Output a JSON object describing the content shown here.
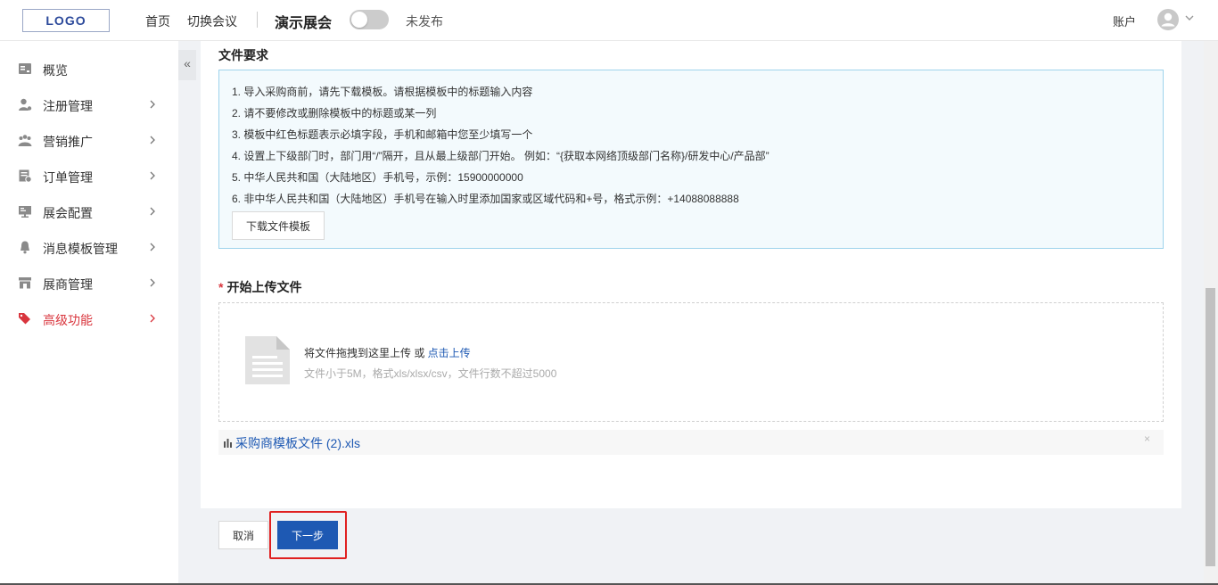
{
  "header": {
    "logo_text": "LOGO",
    "nav_home": "首页",
    "nav_switch": "切换会议",
    "event_title": "演示展会",
    "publish_status": "未发布",
    "account_label": "账户"
  },
  "sidebar": {
    "collapse_label": "«",
    "items": [
      {
        "label": "概览",
        "icon": "overview-icon",
        "has_arrow": false
      },
      {
        "label": "注册管理",
        "icon": "user-manage-icon",
        "has_arrow": true
      },
      {
        "label": "营销推广",
        "icon": "marketing-icon",
        "has_arrow": true
      },
      {
        "label": "订单管理",
        "icon": "order-icon",
        "has_arrow": true
      },
      {
        "label": "展会配置",
        "icon": "monitor-icon",
        "has_arrow": true
      },
      {
        "label": "消息模板管理",
        "icon": "bell-icon",
        "has_arrow": true
      },
      {
        "label": "展商管理",
        "icon": "store-icon",
        "has_arrow": true
      },
      {
        "label": "高级功能",
        "icon": "tags-icon",
        "has_arrow": true,
        "active": true
      }
    ]
  },
  "requirements": {
    "title": "文件要求",
    "lines": [
      "1. 导入采购商前，请先下载模板。请根据模板中的标题输入内容",
      "2. 请不要修改或删除模板中的标题或某一列",
      "3. 模板中红色标题表示必填字段，手机和邮箱中您至少填写一个",
      "4. 设置上下级部门时，部门用“/”隔开，且从最上级部门开始。 例如：“{获取本网络顶级部门名称}/研发中心/产品部”",
      "5. 中华人民共和国（大陆地区）手机号，示例：15900000000",
      "6. 非中华人民共和国（大陆地区）手机号在输入时里添加国家或区域代码和+号，格式示例：+14088088888"
    ],
    "download_button": "下载文件模板"
  },
  "upload": {
    "required_mark": "*",
    "title": "开始上传文件",
    "drop_text": "将文件拖拽到这里上传 或 ",
    "drop_link": "点击上传",
    "drop_hint": "文件小于5M，格式xls/xlsx/csv，文件行数不超过5000",
    "file_name": "采购商模板文件 (2).xls",
    "remove_label": "×"
  },
  "footer": {
    "cancel_label": "取消",
    "next_label": "下一步"
  },
  "colors": {
    "primary": "#1e59b3",
    "active_menu": "#d9363e",
    "highlight": "#e02020"
  }
}
